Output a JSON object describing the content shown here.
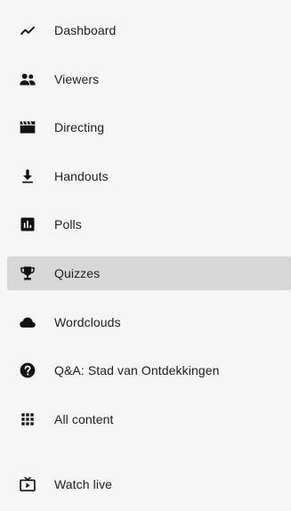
{
  "nav": {
    "items": [
      {
        "label": "Dashboard",
        "icon": "trending-line-icon"
      },
      {
        "label": "Viewers",
        "icon": "people-icon"
      },
      {
        "label": "Directing",
        "icon": "clapperboard-icon"
      },
      {
        "label": "Handouts",
        "icon": "download-icon"
      },
      {
        "label": "Polls",
        "icon": "bar-chart-icon"
      },
      {
        "label": "Quizzes",
        "icon": "trophy-icon",
        "active": true
      },
      {
        "label": "Wordclouds",
        "icon": "cloud-icon"
      },
      {
        "label": "Q&A: Stad van Ontdekkingen",
        "icon": "question-circle-icon"
      },
      {
        "label": "All content",
        "icon": "grid-icon"
      },
      {
        "label": "Watch live",
        "icon": "live-tv-icon"
      }
    ]
  },
  "colors": {
    "background": "#f5f5f5",
    "active_background": "#d7d7d7",
    "text": "#212121",
    "icon": "#111111"
  }
}
